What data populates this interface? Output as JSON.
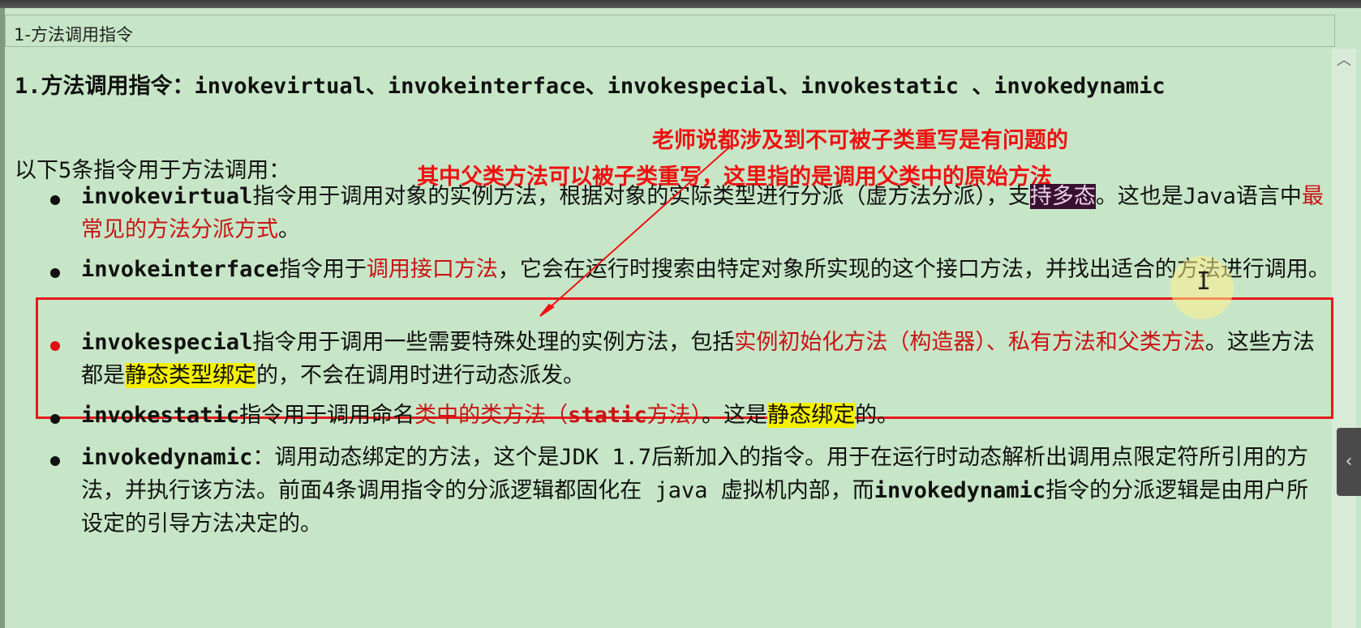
{
  "window": {
    "title": "1-方法调用指令"
  },
  "doc": {
    "heading": "1.方法调用指令：invokevirtual、invokeinterface、invokespecial、invokestatic 、invokedynamic",
    "intro": "以下5条指令用于方法调用：",
    "annotation_line1": "老师说都涉及到不可被子类重写是有问题的",
    "annotation_line2": "其中父类方法可以被子类重写，这里指的是调用父类中的原始方法",
    "items": [
      {
        "code": "invokevirtual",
        "t1": "指令用于调用对象的实例方法，根据对象的实际类型进行分派（虚方法分派），支",
        "t_sel": "持多态",
        "t2": "。这也是Java语言中",
        "t_red": "最常见的方法分派方式",
        "t3": "。"
      },
      {
        "code": "invokeinterface",
        "t1": "指令用于",
        "t_red": "调用接口方法",
        "t2": "，它会在运行时搜索由特定对象所实现的这个接口方法，并找出适合的方法进行调用。"
      },
      {
        "code": "invokespecial",
        "t1": "指令用于调用一些需要特殊处理的实例方法，包括",
        "t_red": "实例初始化方法（构造器）、私有方法和父类方法",
        "t2": "。这些方法都是",
        "t_hl": "静态类型绑定",
        "t3": "的，不会在调用时进行动态派发。"
      },
      {
        "code": "invokestatic",
        "t1": "指令用于调用命名",
        "t_red1": "类中的类方法（",
        "t_red_code": "static",
        "t_red2": "方法）",
        "t2": "。这是",
        "t_hl": "静态绑定",
        "t3": "的。"
      },
      {
        "code": "invokedynamic",
        "t1": "：调用动态绑定的方法，这个是JDK 1.7后新加入的指令。用于在运行时动态解析出调用点限定符所引用的方法，并执行该方法。前面4条调用指令的分派逻辑都固化在 java 虚拟机内部，而",
        "code2": "invokedynamic",
        "t2": "指令的分派逻辑是由用户所设定的引导方法决定的。"
      }
    ]
  },
  "colors": {
    "background": "#c7e6c7",
    "annotation": "#ee1111",
    "emphasis": "#c81414",
    "highlight": "#f5f000",
    "selection": "#3a1030"
  },
  "icons": {
    "scroll_up": "chevron-up-icon",
    "side_tab": "chevron-left-icon"
  }
}
